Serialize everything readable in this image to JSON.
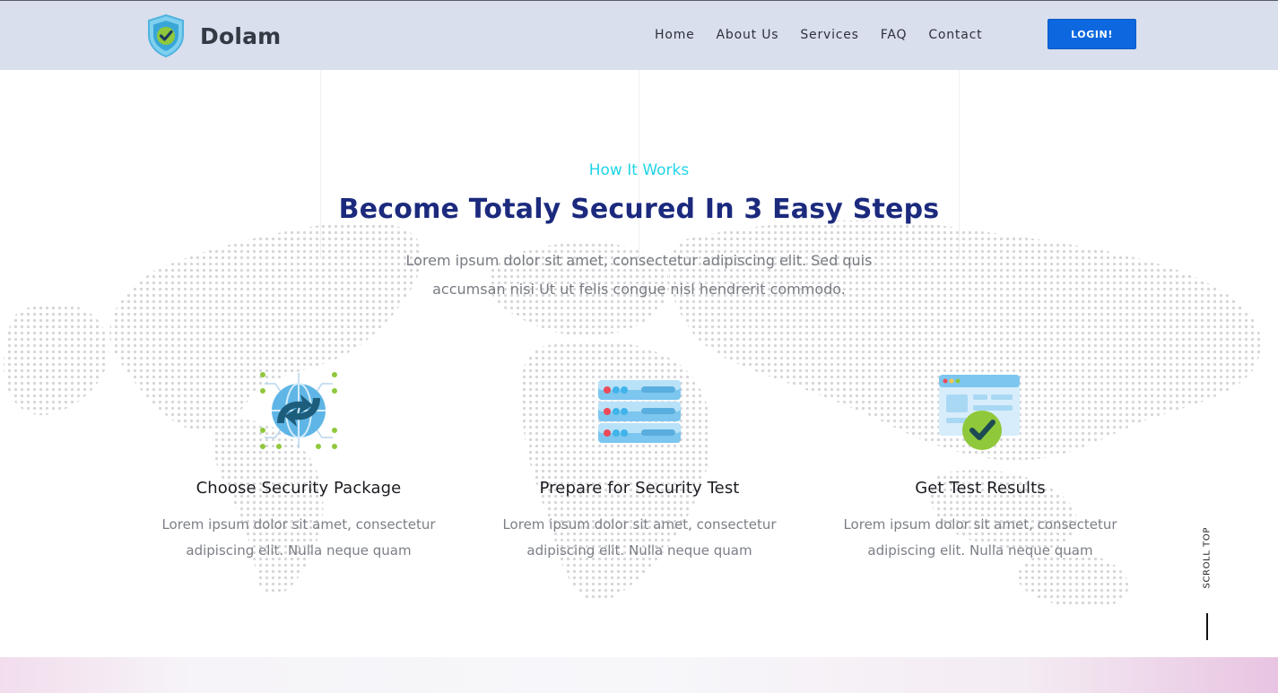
{
  "brand": {
    "name": "Dolam"
  },
  "nav": {
    "items": [
      "Home",
      "About Us",
      "Services",
      "FAQ",
      "Contact"
    ],
    "login_label": "LOGIN!"
  },
  "section": {
    "eyebrow": "How It Works",
    "title": "Become Totaly Secured In 3 Easy Steps",
    "lead": "Lorem ipsum dolor sit amet, consectetur adipiscing elit. Sed quis accumsan nisi Ut ut felis congue nisl hendrerit commodo."
  },
  "steps": [
    {
      "icon": "globe-sync-icon",
      "title": "Choose Security Package",
      "desc": "Lorem ipsum dolor sit amet, consectetur adipiscing elit. Nulla neque quam"
    },
    {
      "icon": "server-icon",
      "title": "Prepare for Security Test",
      "desc": "Lorem ipsum dolor sit amet, consectetur adipiscing elit. Nulla neque quam"
    },
    {
      "icon": "browser-check-icon",
      "title": "Get Test Results",
      "desc": "Lorem ipsum dolor sit amet, consectetur adipiscing elit. Nulla neque quam"
    }
  ],
  "scroll_top": {
    "label": "SCROLL TOP"
  },
  "colors": {
    "header_bg": "#d9dfed",
    "accent_cyan": "#21d4e6",
    "title_navy": "#1b2a7d",
    "button_blue": "#0d68e0",
    "check_green": "#8fc83a"
  }
}
